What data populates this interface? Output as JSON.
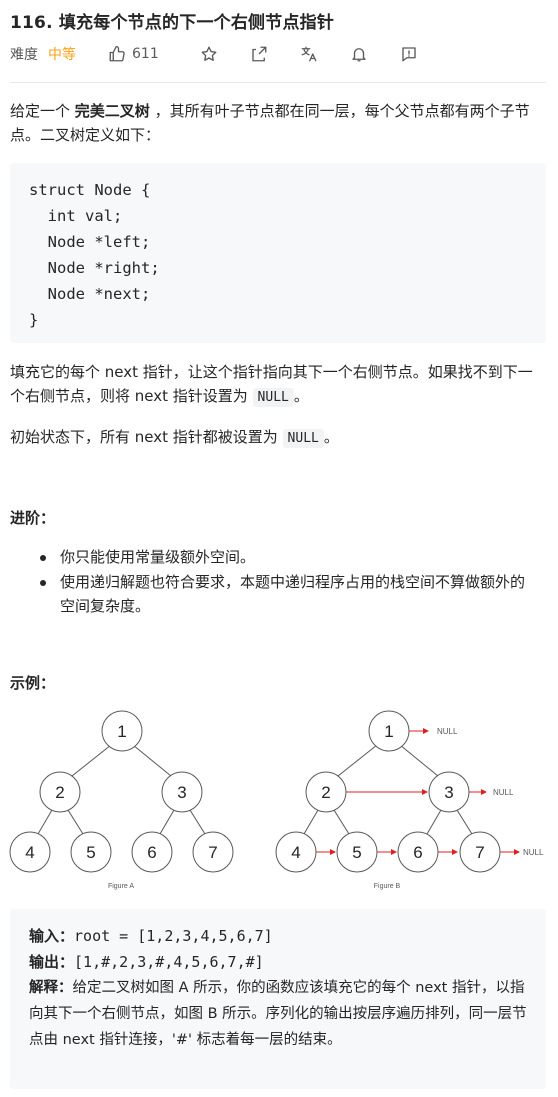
{
  "problem": {
    "title": "116. 填充每个节点的下一个右侧节点指针",
    "difficulty_label": "难度",
    "difficulty": "中等",
    "likes": "611"
  },
  "intro": {
    "before": "给定一个 ",
    "bold": "完美二叉树",
    "after": " ，其所有叶子节点都在同一层，每个父节点都有两个子节点。二叉树定义如下："
  },
  "code": "struct Node {\n  int val;\n  Node *left;\n  Node *right;\n  Node *next;\n}",
  "desc1": {
    "text": "填充它的每个 next 指针，让这个指针指向其下一个右侧节点。如果找不到下一个右侧节点，则将 next 指针设置为 ",
    "code": "NULL",
    "end": "。"
  },
  "desc2": {
    "text": "初始状态下，所有 next 指针都被设置为 ",
    "code": "NULL",
    "end": "。"
  },
  "advanced": {
    "heading": "进阶：",
    "items": [
      "你只能使用常量级额外空间。",
      "使用递归解题也符合要求，本题中递归程序占用的栈空间不算做额外的空间复杂度。"
    ]
  },
  "example": {
    "heading": "示例：",
    "figure_a": {
      "caption": "Figure A",
      "nodes": [
        "1",
        "2",
        "3",
        "4",
        "5",
        "6",
        "7"
      ]
    },
    "figure_b": {
      "caption": "Figure B",
      "nodes": [
        "1",
        "2",
        "3",
        "4",
        "5",
        "6",
        "7"
      ],
      "null_label": "NULL"
    },
    "input_label": "输入：",
    "input": "root = [1,2,3,4,5,6,7]",
    "output_label": "输出：",
    "output": "[1,#,2,3,#,4,5,6,7,#]",
    "explain_label": "解释：",
    "explain": "给定二叉树如图 A 所示，你的函数应该填充它的每个 next 指针，以指向其下一个右侧节点，如图 B 所示。序列化的输出按层序遍历排列，同一层节点由 next 指针连接，'#' 标志着每一层的结束。"
  },
  "colors": {
    "difficulty_medium": "#ffa116",
    "arrow_red": "#e02020",
    "code_bg": "#f7f8fa"
  },
  "icons": [
    "thumbs-up-icon",
    "star-icon",
    "share-icon",
    "translate-icon",
    "bell-icon",
    "feedback-icon"
  ]
}
